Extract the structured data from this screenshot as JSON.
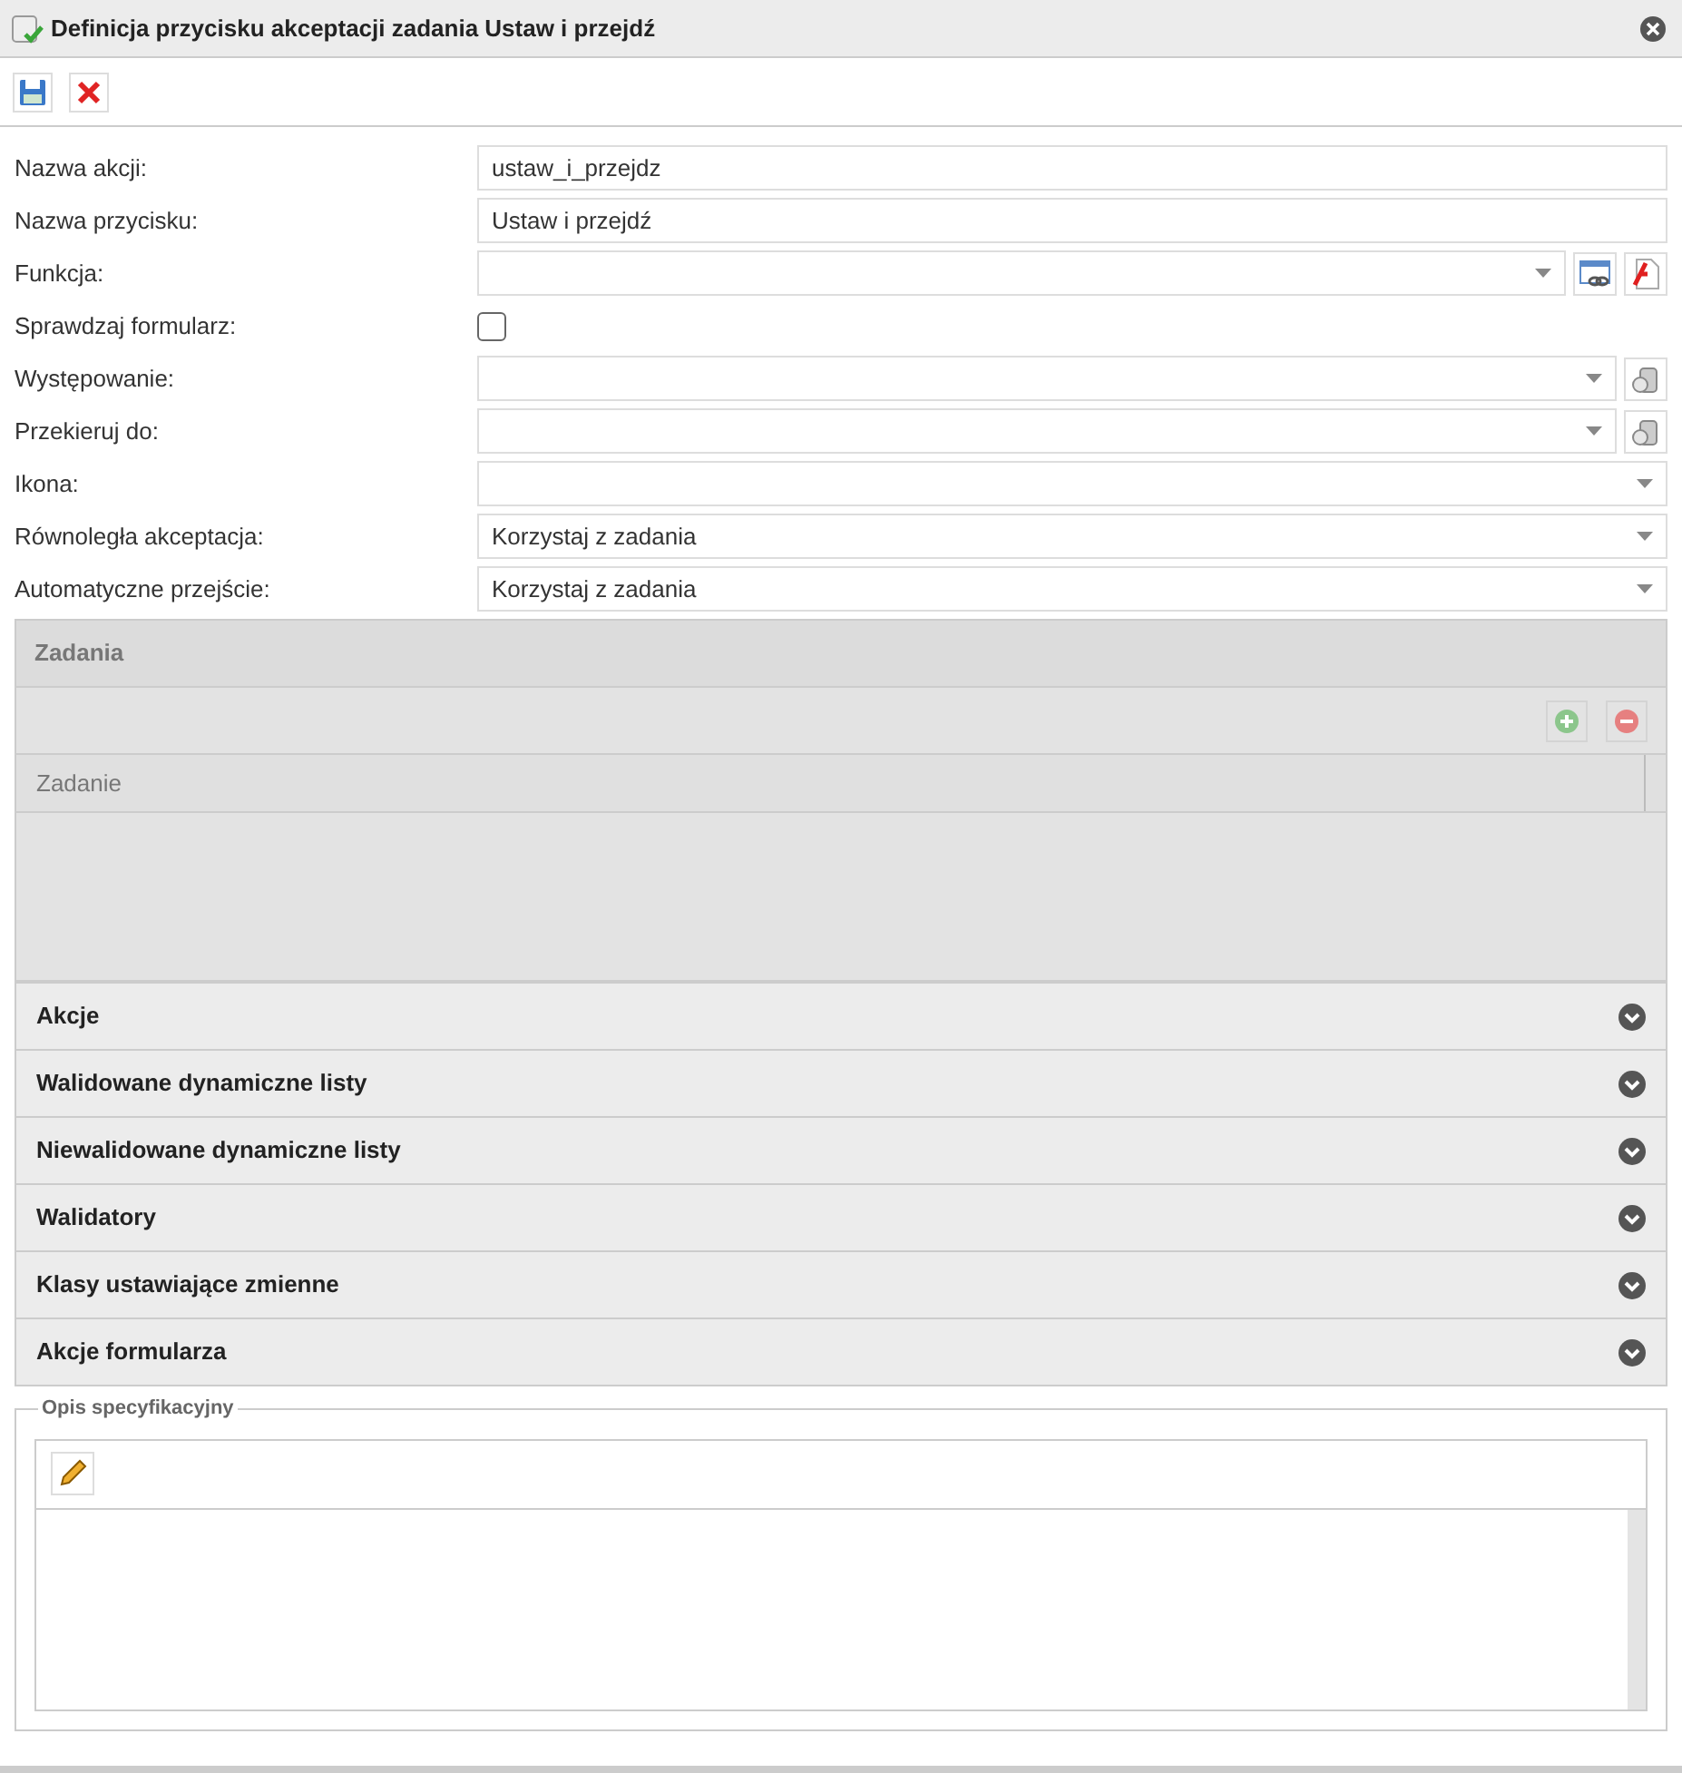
{
  "window": {
    "title": "Definicja przycisku akceptacji zadania Ustaw i przejdź"
  },
  "toolbar": [
    {
      "kind": "save"
    },
    {
      "kind": "cancel"
    }
  ],
  "form": [
    {
      "kind": "text",
      "label": "Nazwa akcji:",
      "value": "ustaw_i_przejdz"
    },
    {
      "kind": "text",
      "label": "Nazwa przycisku:",
      "value": "Ustaw i przejdź"
    },
    {
      "kind": "select",
      "label": "Funkcja:",
      "actions": [
        {
          "kind": "link"
        },
        {
          "kind": "script"
        }
      ]
    },
    {
      "kind": "checkbox",
      "label": "Sprawdzaj formularz:",
      "checked": false
    },
    {
      "kind": "select",
      "label": "Występowanie:",
      "actions": [
        {
          "kind": "trash"
        }
      ]
    },
    {
      "kind": "select",
      "label": "Przekieruj do:",
      "actions": [
        {
          "kind": "trash"
        }
      ]
    },
    {
      "kind": "select",
      "label": "Ikona:"
    },
    {
      "kind": "select",
      "label": "Równoległa akceptacja:",
      "value": "Korzystaj z zadania"
    },
    {
      "kind": "select",
      "label": "Automatyczne przejście:",
      "value": "Korzystaj z zadania"
    }
  ],
  "tasks_panel": {
    "title": "Zadania",
    "columns": [
      "Zadanie"
    ]
  },
  "sections": [
    {
      "label": "Akcje",
      "expanded": false
    },
    {
      "label": "Walidowane dynamiczne listy",
      "expanded": false
    },
    {
      "label": "Niewalidowane dynamiczne listy",
      "expanded": false
    },
    {
      "label": "Walidatory",
      "expanded": false
    },
    {
      "label": "Klasy ustawiające zmienne",
      "expanded": false
    },
    {
      "label": "Akcje formularza",
      "expanded": false
    }
  ],
  "spec": {
    "legend": "Opis specyfikacyjny"
  }
}
